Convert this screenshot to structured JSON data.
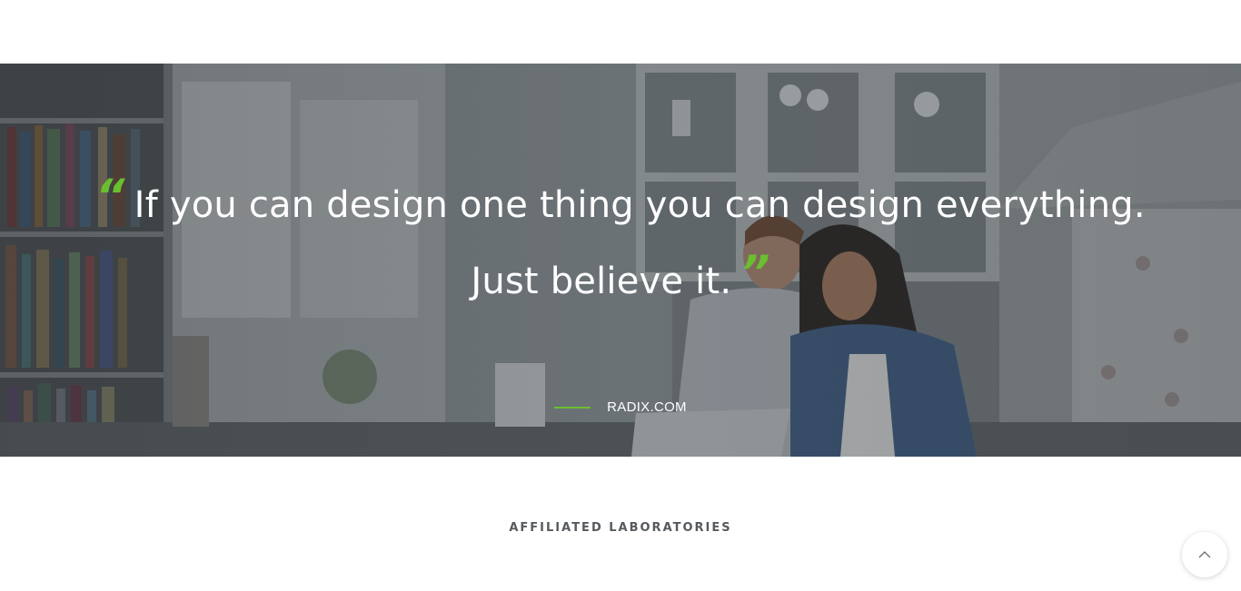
{
  "quote": {
    "line1": "If you can design one thing you can design everything.",
    "line2": "Just believe it.",
    "open_mark": "“",
    "close_mark": "”",
    "source": "RADIX.COM"
  },
  "section": {
    "title": "AFFILIATED LABORATORIES"
  },
  "back_to_top": {
    "icon": "chevron-up-icon"
  },
  "colors": {
    "accent": "#6abf2e",
    "quote_text": "#ffffff",
    "section_title": "#555a5e"
  }
}
